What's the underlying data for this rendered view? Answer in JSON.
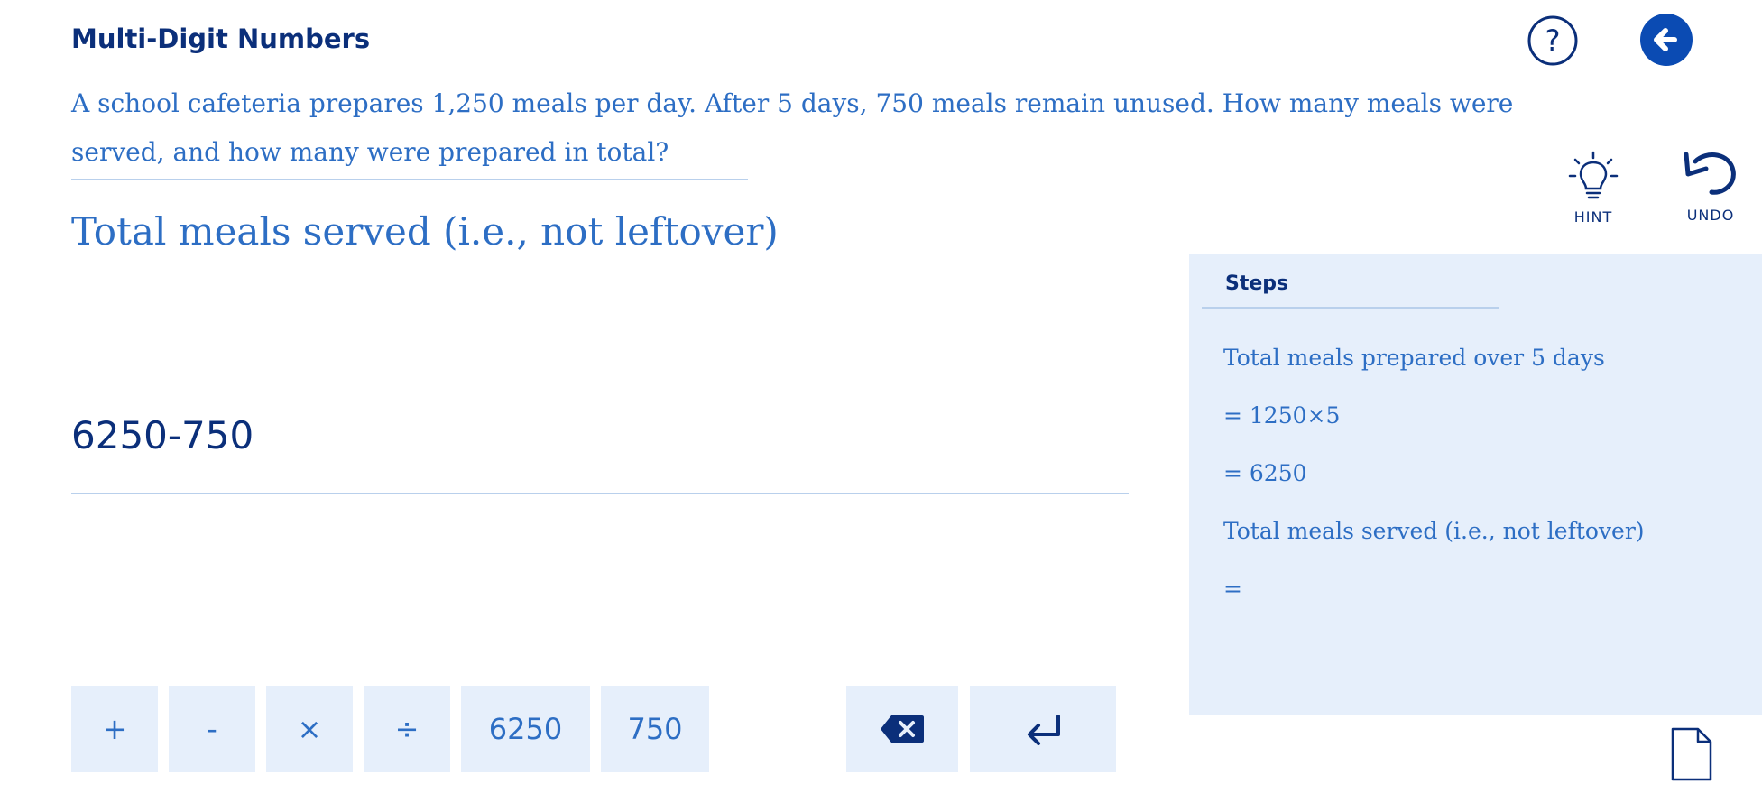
{
  "header": {
    "title": "Multi-Digit Numbers"
  },
  "question": {
    "text": "A school cafeteria prepares 1,250 meals per day. After 5 days, 750 meals remain unused. How many meals were served, and how many were prepared in total?"
  },
  "prompt": {
    "label": "Total meals served (i.e., not leftover)"
  },
  "answer": {
    "value": "6250-750"
  },
  "toolbar": {
    "hint_label": "HINT",
    "undo_label": "UNDO"
  },
  "steps": {
    "title": "Steps",
    "lines": [
      "Total meals prepared over 5 days",
      "= 1250×5",
      "= 6250",
      "Total meals served (i.e., not leftover)",
      "="
    ]
  },
  "keypad": {
    "keys": [
      "+",
      "-",
      "×",
      "÷",
      "6250",
      "750"
    ]
  },
  "icons": {
    "help": "help-circle-icon",
    "back": "back-arrow-icon",
    "hint": "lightbulb-icon",
    "undo": "undo-icon",
    "backspace": "backspace-icon",
    "enter": "enter-icon",
    "document": "document-icon"
  },
  "colors": {
    "primary": "#0b2f7a",
    "accent": "#2d6ec4",
    "panel": "#e6effb",
    "rule": "#b9d0ec"
  }
}
